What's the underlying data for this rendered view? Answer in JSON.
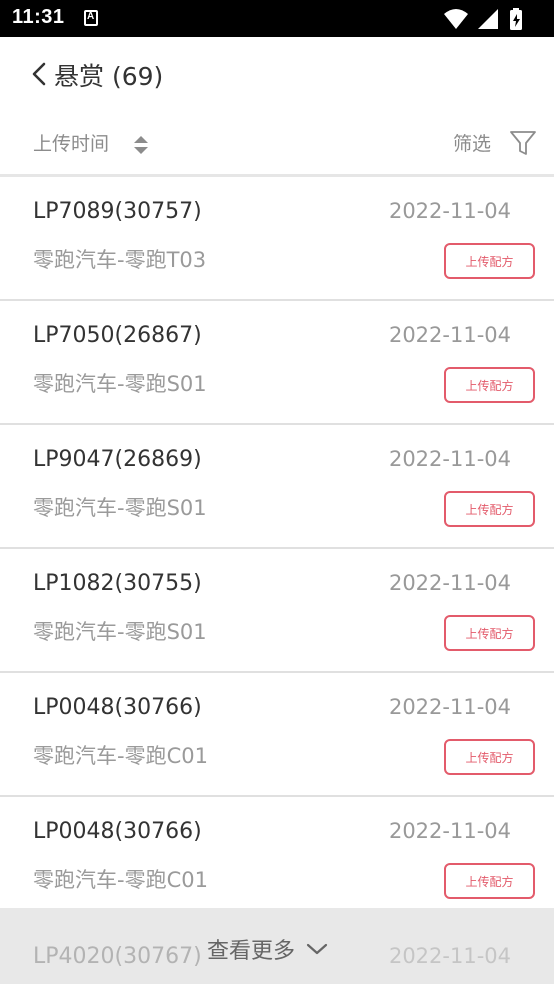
{
  "status_bar": {
    "time": "11:31",
    "notification_icon": "a-icon",
    "icons": [
      "wifi-icon",
      "signal-icon",
      "battery-icon"
    ]
  },
  "header": {
    "back_icon": "chevron-left-icon",
    "title": "悬赏 (69)"
  },
  "sort_bar": {
    "sort_label": "上传时间",
    "sort_icon": "sort-updown-icon",
    "filter_label": "筛选",
    "filter_icon": "funnel-icon"
  },
  "items": [
    {
      "code": "LP7089(30757)",
      "date": "2022-11-04",
      "model": "零跑汽车-零跑T03",
      "button": "上传配方"
    },
    {
      "code": "LP7050(26867)",
      "date": "2022-11-04",
      "model": "零跑汽车-零跑S01",
      "button": "上传配方"
    },
    {
      "code": "LP9047(26869)",
      "date": "2022-11-04",
      "model": "零跑汽车-零跑S01",
      "button": "上传配方"
    },
    {
      "code": "LP1082(30755)",
      "date": "2022-11-04",
      "model": "零跑汽车-零跑S01",
      "button": "上传配方"
    },
    {
      "code": "LP0048(30766)",
      "date": "2022-11-04",
      "model": "零跑汽车-零跑C01",
      "button": "上传配方"
    },
    {
      "code": "LP0048(30766)",
      "date": "2022-11-04",
      "model": "零跑汽车-零跑C01",
      "button": "上传配方"
    }
  ],
  "partial_item": {
    "code": "LP4020(30767)",
    "date": "2022-11-04"
  },
  "load_more": {
    "label": "查看更多",
    "icon": "chevron-down-icon"
  },
  "colors": {
    "accent_red": "#e35b6b",
    "muted_text": "#999999",
    "status_bar": "#000000"
  }
}
